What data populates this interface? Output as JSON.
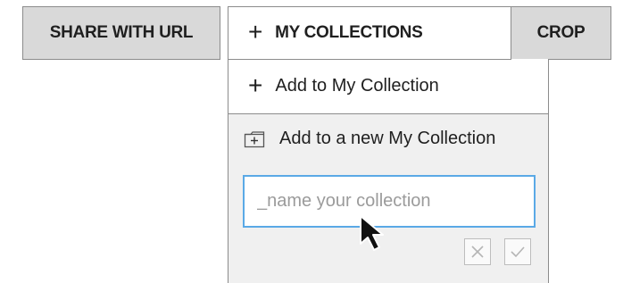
{
  "toolbar": {
    "share_label": "SHARE WITH URL",
    "collections_plus": "+",
    "collections_label": "MY COLLECTIONS",
    "crop_label": "CROP"
  },
  "dropdown": {
    "add_plus": "+",
    "add_label": "Add to My Collection",
    "new_collection_label": "Add to a new My Collection",
    "name_input": {
      "value": "",
      "placeholder": "_name your collection"
    }
  },
  "icons": {
    "folder": "folder-add-icon",
    "cancel": "close-icon",
    "confirm": "check-icon",
    "cursor": "mouse-pointer-icon"
  },
  "colors": {
    "button_gray": "#d9d9d9",
    "panel_gray": "#f0f0f0",
    "input_focus_border": "#5aa9e6",
    "border": "#8c8c8c",
    "text": "#1f1f1f"
  }
}
